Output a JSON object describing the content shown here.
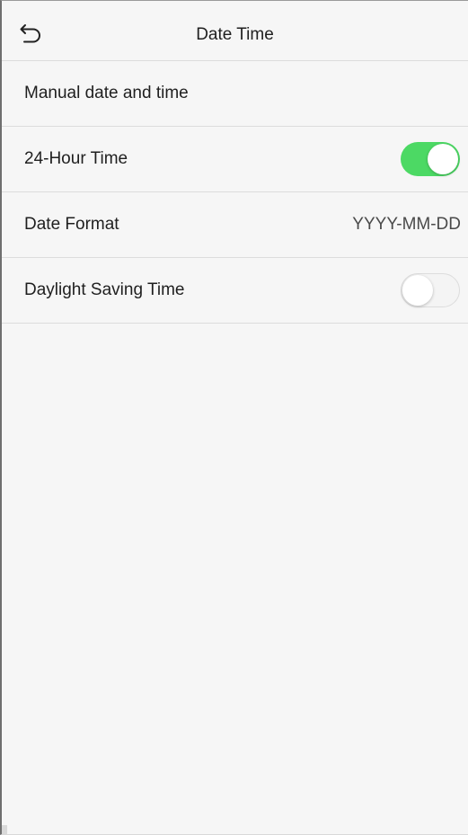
{
  "header": {
    "title": "Date Time",
    "back_icon": "back-arrow-icon"
  },
  "settings": [
    {
      "label": "Manual date and time"
    },
    {
      "label": "24-Hour Time",
      "toggle": true
    },
    {
      "label": "Date Format",
      "value": "YYYY-MM-DD"
    },
    {
      "label": "Daylight Saving Time",
      "toggle": false
    }
  ],
  "colors": {
    "toggle_on": "#4cd964",
    "background": "#f6f6f6",
    "divider": "#dcdcdc"
  }
}
